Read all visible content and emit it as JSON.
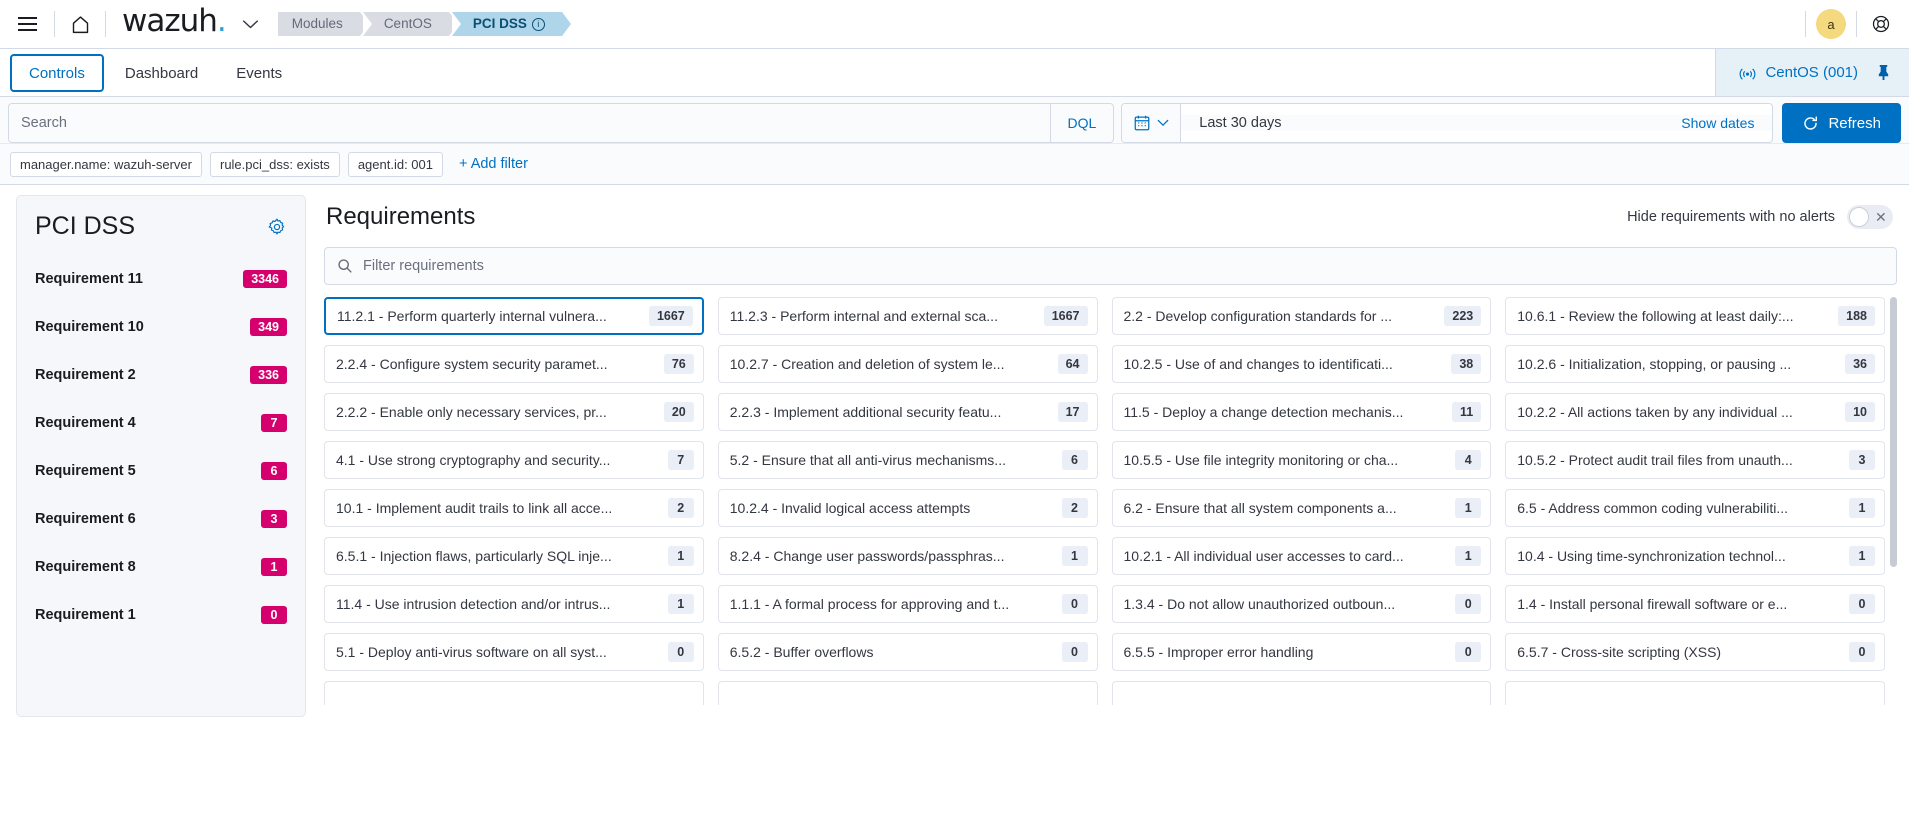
{
  "topnav": {
    "menu_icon": "hamburger-icon",
    "home_icon": "home-icon",
    "brand": "wazuh",
    "brand_dot": ".",
    "chevron": "⌄",
    "breadcrumbs": [
      {
        "label": "Modules",
        "active": false
      },
      {
        "label": "CentOS",
        "active": false
      },
      {
        "label": "PCI DSS",
        "active": true,
        "info": "ⓘ"
      }
    ],
    "avatar_initial": "a",
    "help_icon": "lifebuoy-icon"
  },
  "tabs": [
    {
      "label": "Controls",
      "active": true
    },
    {
      "label": "Dashboard",
      "active": false
    },
    {
      "label": "Events",
      "active": false
    }
  ],
  "agent_selector": {
    "icon": "signal-icon",
    "label": "CentOS (001)",
    "pin_icon": "pin-icon"
  },
  "search": {
    "placeholder": "Search",
    "value": "",
    "dql_label": "DQL",
    "calendar_icon": "calendar-icon",
    "date_range": "Last 30 days",
    "show_dates_label": "Show dates",
    "refresh_label": "Refresh",
    "refresh_icon": "refresh-icon"
  },
  "filters": {
    "pills": [
      "manager.name: wazuh-server",
      "rule.pci_dss: exists",
      "agent.id: 001"
    ],
    "add_filter_label": "+ Add filter"
  },
  "sidebar": {
    "title": "PCI DSS",
    "gear_icon": "gear-icon",
    "items": [
      {
        "label": "Requirement 11",
        "count": "3346"
      },
      {
        "label": "Requirement 10",
        "count": "349"
      },
      {
        "label": "Requirement 2",
        "count": "336"
      },
      {
        "label": "Requirement 4",
        "count": "7"
      },
      {
        "label": "Requirement 5",
        "count": "6"
      },
      {
        "label": "Requirement 6",
        "count": "3"
      },
      {
        "label": "Requirement 8",
        "count": "1"
      },
      {
        "label": "Requirement 1",
        "count": "0"
      }
    ]
  },
  "main": {
    "title": "Requirements",
    "hide_label": "Hide requirements with no alerts",
    "toggle_state": "off",
    "toggle_mark": "✕",
    "filter_placeholder": "Filter requirements",
    "search_icon": "search-icon",
    "cards": [
      {
        "text": "11.2.1 - Perform quarterly internal vulnera...",
        "count": "1667",
        "selected": true
      },
      {
        "text": "11.2.3 - Perform internal and external sca...",
        "count": "1667",
        "selected": false
      },
      {
        "text": "2.2 - Develop configuration standards for ...",
        "count": "223",
        "selected": false
      },
      {
        "text": "10.6.1 - Review the following at least daily:...",
        "count": "188",
        "selected": false
      },
      {
        "text": "2.2.4 - Configure system security paramet...",
        "count": "76",
        "selected": false
      },
      {
        "text": "10.2.7 - Creation and deletion of system le...",
        "count": "64",
        "selected": false
      },
      {
        "text": "10.2.5 - Use of and changes to identificati...",
        "count": "38",
        "selected": false
      },
      {
        "text": "10.2.6 - Initialization, stopping, or pausing ...",
        "count": "36",
        "selected": false
      },
      {
        "text": "2.2.2 - Enable only necessary services, pr...",
        "count": "20",
        "selected": false
      },
      {
        "text": "2.2.3 - Implement additional security featu...",
        "count": "17",
        "selected": false
      },
      {
        "text": "11.5 - Deploy a change detection mechanis...",
        "count": "11",
        "selected": false
      },
      {
        "text": "10.2.2 - All actions taken by any individual ...",
        "count": "10",
        "selected": false
      },
      {
        "text": "4.1 - Use strong cryptography and security...",
        "count": "7",
        "selected": false
      },
      {
        "text": "5.2 - Ensure that all anti-virus mechanisms...",
        "count": "6",
        "selected": false
      },
      {
        "text": "10.5.5 - Use file integrity monitoring or cha...",
        "count": "4",
        "selected": false
      },
      {
        "text": "10.5.2 - Protect audit trail files from unauth...",
        "count": "3",
        "selected": false
      },
      {
        "text": "10.1 - Implement audit trails to link all acce...",
        "count": "2",
        "selected": false
      },
      {
        "text": "10.2.4 - Invalid logical access attempts",
        "count": "2",
        "selected": false
      },
      {
        "text": "6.2 - Ensure that all system components a...",
        "count": "1",
        "selected": false
      },
      {
        "text": "6.5 - Address common coding vulnerabiliti...",
        "count": "1",
        "selected": false
      },
      {
        "text": "6.5.1 - Injection flaws, particularly SQL inje...",
        "count": "1",
        "selected": false
      },
      {
        "text": "8.2.4 - Change user passwords/passphras...",
        "count": "1",
        "selected": false
      },
      {
        "text": "10.2.1 - All individual user accesses to card...",
        "count": "1",
        "selected": false
      },
      {
        "text": "10.4 - Using time-synchronization technol...",
        "count": "1",
        "selected": false
      },
      {
        "text": "11.4 - Use intrusion detection and/or intrus...",
        "count": "1",
        "selected": false
      },
      {
        "text": "1.1.1 - A formal process for approving and t...",
        "count": "0",
        "selected": false
      },
      {
        "text": "1.3.4 - Do not allow unauthorized outboun...",
        "count": "0",
        "selected": false
      },
      {
        "text": "1.4 - Install personal firewall software or e...",
        "count": "0",
        "selected": false
      },
      {
        "text": "5.1 - Deploy anti-virus software on all syst...",
        "count": "0",
        "selected": false
      },
      {
        "text": "6.5.2 - Buffer overflows",
        "count": "0",
        "selected": false
      },
      {
        "text": "6.5.5 - Improper error handling",
        "count": "0",
        "selected": false
      },
      {
        "text": "6.5.7 - Cross-site scripting (XSS)",
        "count": "0",
        "selected": false
      }
    ]
  },
  "colors": {
    "accent_blue": "#0071c2",
    "badge_magenta": "#d5006d",
    "crumb_active_bg": "#afd5ea",
    "avatar_bg": "#f5d97e"
  }
}
